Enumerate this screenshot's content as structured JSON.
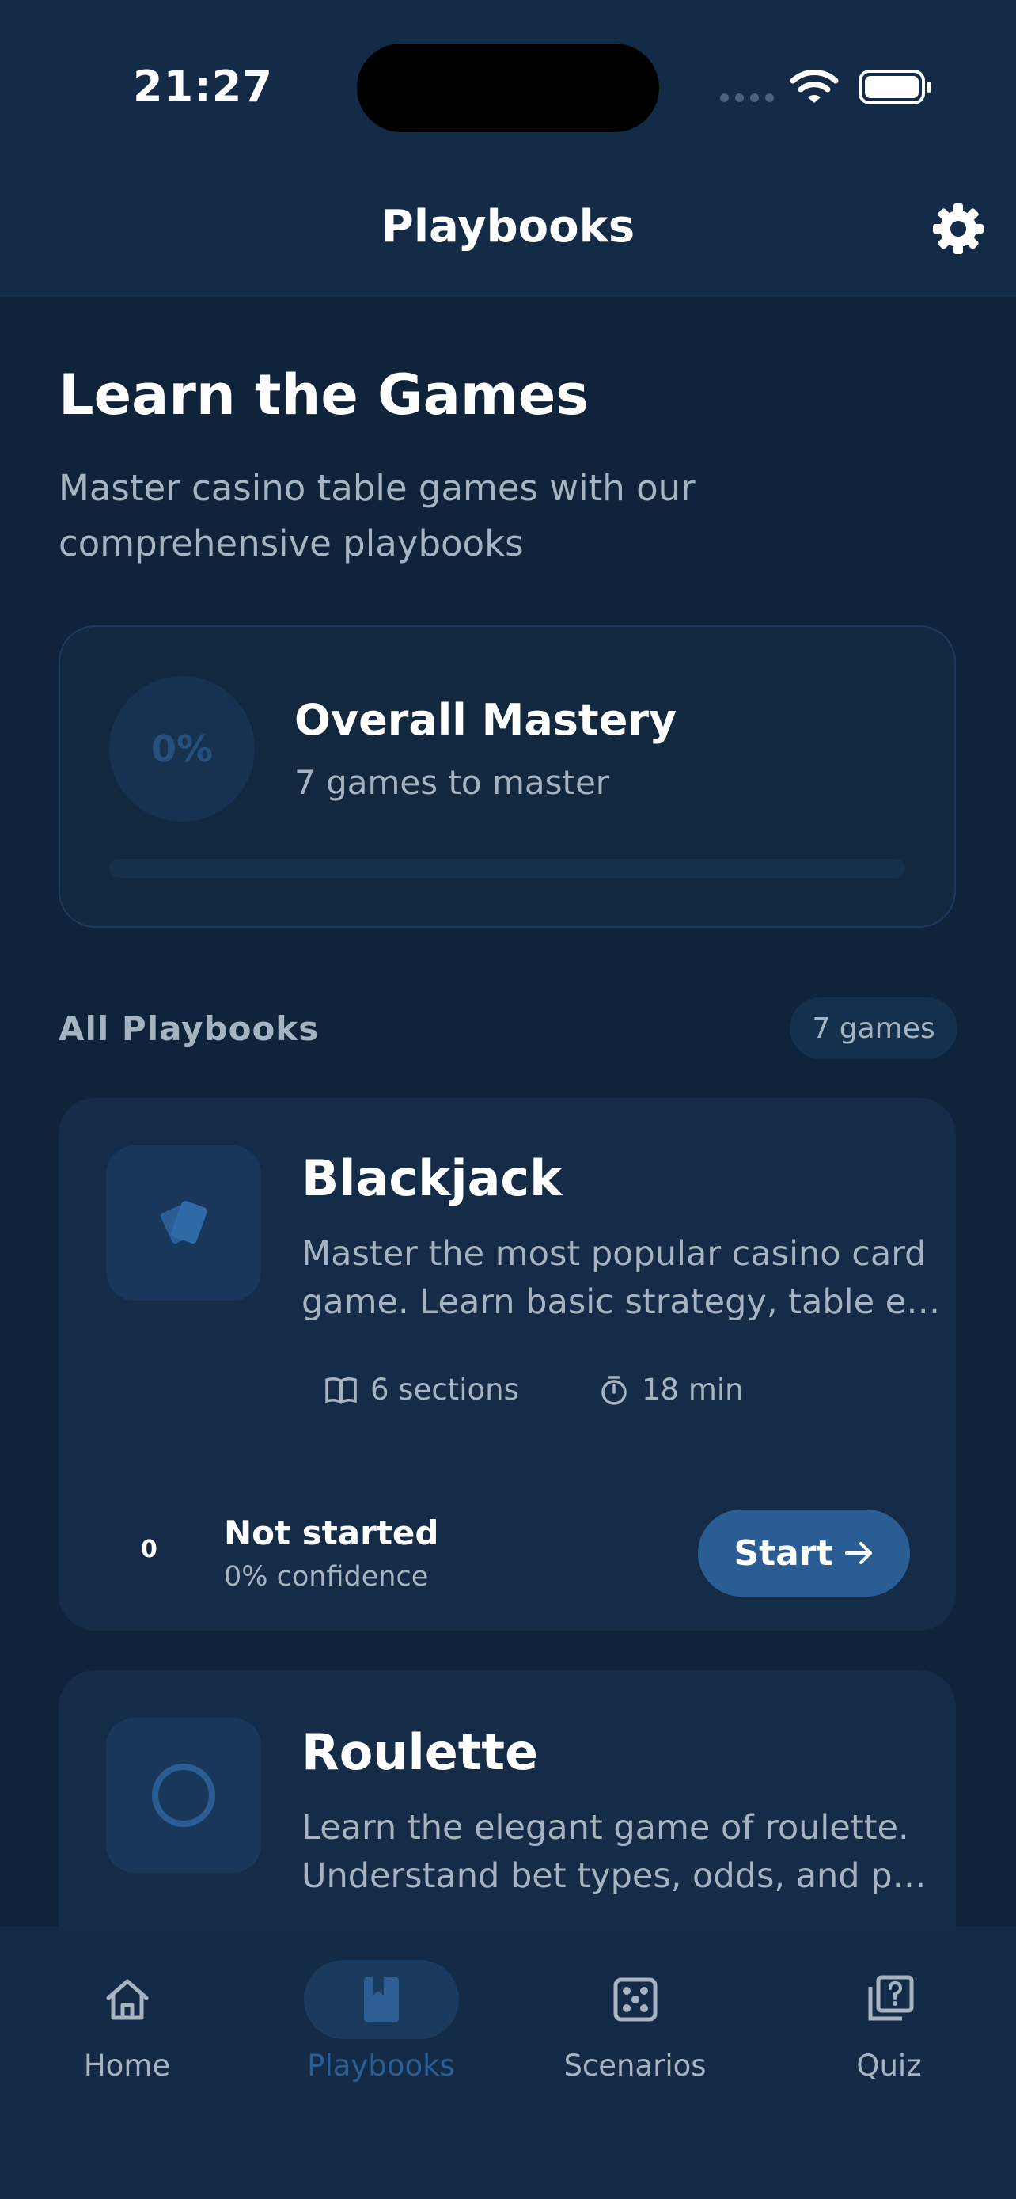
{
  "status_bar": {
    "time": "21:27"
  },
  "header": {
    "title": "Playbooks"
  },
  "hero": {
    "title": "Learn the Games",
    "subtitle": "Master casino table games with our comprehensive playbooks"
  },
  "mastery": {
    "percent_label": "0%",
    "progress": 0,
    "title": "Overall Mastery",
    "subtitle": "7 games to master"
  },
  "section": {
    "label": "All Playbooks",
    "count_badge": "7 games"
  },
  "playbooks": [
    {
      "title": "Blackjack",
      "description": "Master the most popular casino card game. Learn basic strategy, table e…",
      "sections": "6 sections",
      "duration": "18 min",
      "count": "0",
      "status": "Not started",
      "confidence": "0% confidence",
      "button": "Start"
    },
    {
      "title": "Roulette",
      "description": "Learn the elegant game of roulette. Understand bet types, odds, and p…"
    }
  ],
  "tabs": [
    {
      "label": "Home",
      "icon": "home-icon"
    },
    {
      "label": "Playbooks",
      "icon": "book-icon",
      "active": true
    },
    {
      "label": "Scenarios",
      "icon": "dice-icon"
    },
    {
      "label": "Quiz",
      "icon": "quiz-icon"
    }
  ],
  "colors": {
    "background": "#0f233a",
    "accent": "#2a5d93",
    "muted_text": "#a6b4c2"
  }
}
